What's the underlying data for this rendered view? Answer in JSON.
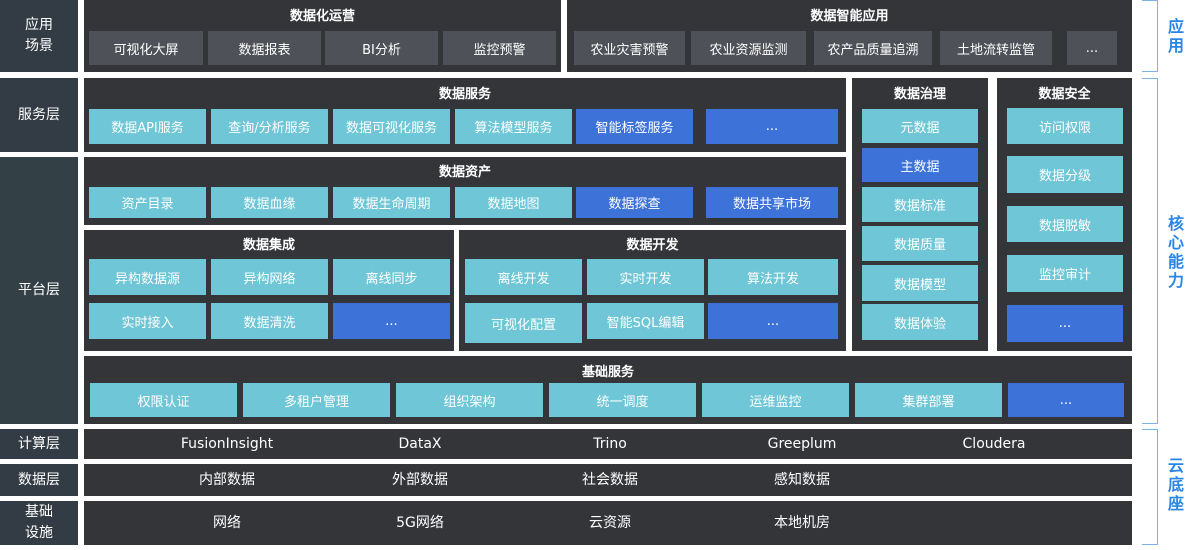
{
  "row_labels": {
    "application": "应用\n场景",
    "service": "服务层",
    "platform": "平台层",
    "compute": "计算层",
    "data": "数据层",
    "infra": "基础\n设施"
  },
  "app_ops": {
    "title": "数据化运营",
    "items": [
      "可视化大屏",
      "数据报表",
      "BI分析",
      "监控预警"
    ]
  },
  "app_smart": {
    "title": "数据智能应用",
    "items": [
      "农业灾害预警",
      "农业资源监测",
      "农产品质量追溯",
      "土地流转监管",
      "..."
    ]
  },
  "data_service": {
    "title": "数据服务",
    "items": [
      "数据API服务",
      "查询/分析服务",
      "数据可视化服务",
      "算法模型服务",
      "智能标签服务",
      "..."
    ]
  },
  "data_asset": {
    "title": "数据资产",
    "items": [
      "资产目录",
      "数据血缘",
      "数据生命周期",
      "数据地图",
      "数据探查",
      "数据共享市场"
    ]
  },
  "data_integration": {
    "title": "数据集成",
    "items": [
      "异构数据源",
      "异构网络",
      "离线同步",
      "实时接入",
      "数据清洗",
      "..."
    ]
  },
  "data_dev": {
    "title": "数据开发",
    "items": [
      "离线开发",
      "实时开发",
      "算法开发",
      "可视化配置",
      "智能SQL编辑",
      "..."
    ]
  },
  "governance": {
    "title": "数据治理",
    "items": [
      "元数据",
      "主数据",
      "数据标准",
      "数据质量",
      "数据模型",
      "数据体验"
    ]
  },
  "security": {
    "title": "数据安全",
    "items": [
      "访问权限",
      "数据分级",
      "数据脱敏",
      "监控审计",
      "..."
    ]
  },
  "base_service": {
    "title": "基础服务",
    "items": [
      "权限认证",
      "多租户管理",
      "组织架构",
      "统一调度",
      "运维监控",
      "集群部署",
      "..."
    ]
  },
  "compute_items": [
    "FusionInsight",
    "DataX",
    "Trino",
    "Greeplum",
    "Cloudera"
  ],
  "data_items": [
    "内部数据",
    "外部数据",
    "社会数据",
    "感知数据"
  ],
  "infra_items": [
    "网络",
    "5G网络",
    "云资源",
    "本地机房"
  ],
  "side_labels": {
    "application": "应用",
    "core": "核心能力",
    "cloud": "云底座"
  },
  "colors": {
    "panel": "#333539",
    "cell_grey": "#4e5157",
    "cell_cyan": "#6ec6d6",
    "cell_blue": "#3d72d8",
    "side_text": "#2a86e6"
  }
}
